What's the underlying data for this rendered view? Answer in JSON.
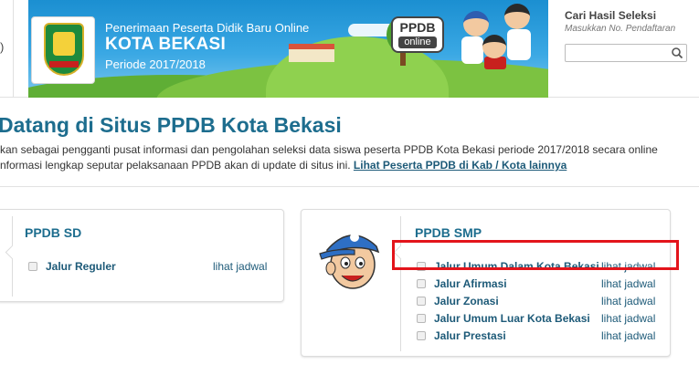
{
  "header": {
    "left_edge_mark": ")",
    "banner": {
      "line1": "Penerimaan Peserta Didik Baru Online",
      "title": "KOTA BEKASI",
      "period": "Periode 2017/2018",
      "badge_top": "PPDB",
      "badge_bottom": "online"
    },
    "search": {
      "title": "Cari Hasil Seleksi",
      "hint": "Masukkan No. Pendaftaran",
      "value": ""
    }
  },
  "welcome": {
    "heading": "Datang di Situs PPDB Kota Bekasi",
    "line1": "kan sebagai pengganti pusat informasi dan pengolahan seleksi data siswa peserta PPDB Kota Bekasi periode 2017/2018 secara online",
    "line2_text": "nformasi lengkap seputar pelaksanaan PPDB akan di update di situs ini. ",
    "line2_link": "Lihat Peserta PPDB di Kab / Kota lainnya"
  },
  "sd": {
    "title": "PPDB SD",
    "rows": [
      {
        "label": "Jalur Reguler",
        "link": "lihat jadwal"
      }
    ]
  },
  "smp": {
    "title": "PPDB SMP",
    "rows": [
      {
        "label": "Jalur Umum Dalam Kota Bekasi",
        "link": "lihat jadwal"
      },
      {
        "label": "Jalur Afirmasi",
        "link": "lihat jadwal"
      },
      {
        "label": "Jalur Zonasi",
        "link": "lihat jadwal"
      },
      {
        "label": "Jalur Umum Luar Kota Bekasi",
        "link": "lihat jadwal"
      },
      {
        "label": "Jalur Prestasi",
        "link": "lihat jadwal"
      }
    ]
  },
  "colors": {
    "accent": "#1d6d8e",
    "link": "#1d5a78",
    "highlight": "#e3141b",
    "banner_sky": "#1b8fd1",
    "banner_grass": "#7cc241"
  },
  "icons": {
    "search": "search-icon",
    "city_logo": "kota-bekasi-emblem-icon",
    "mascot": "mascot-boy-cap-icon"
  }
}
